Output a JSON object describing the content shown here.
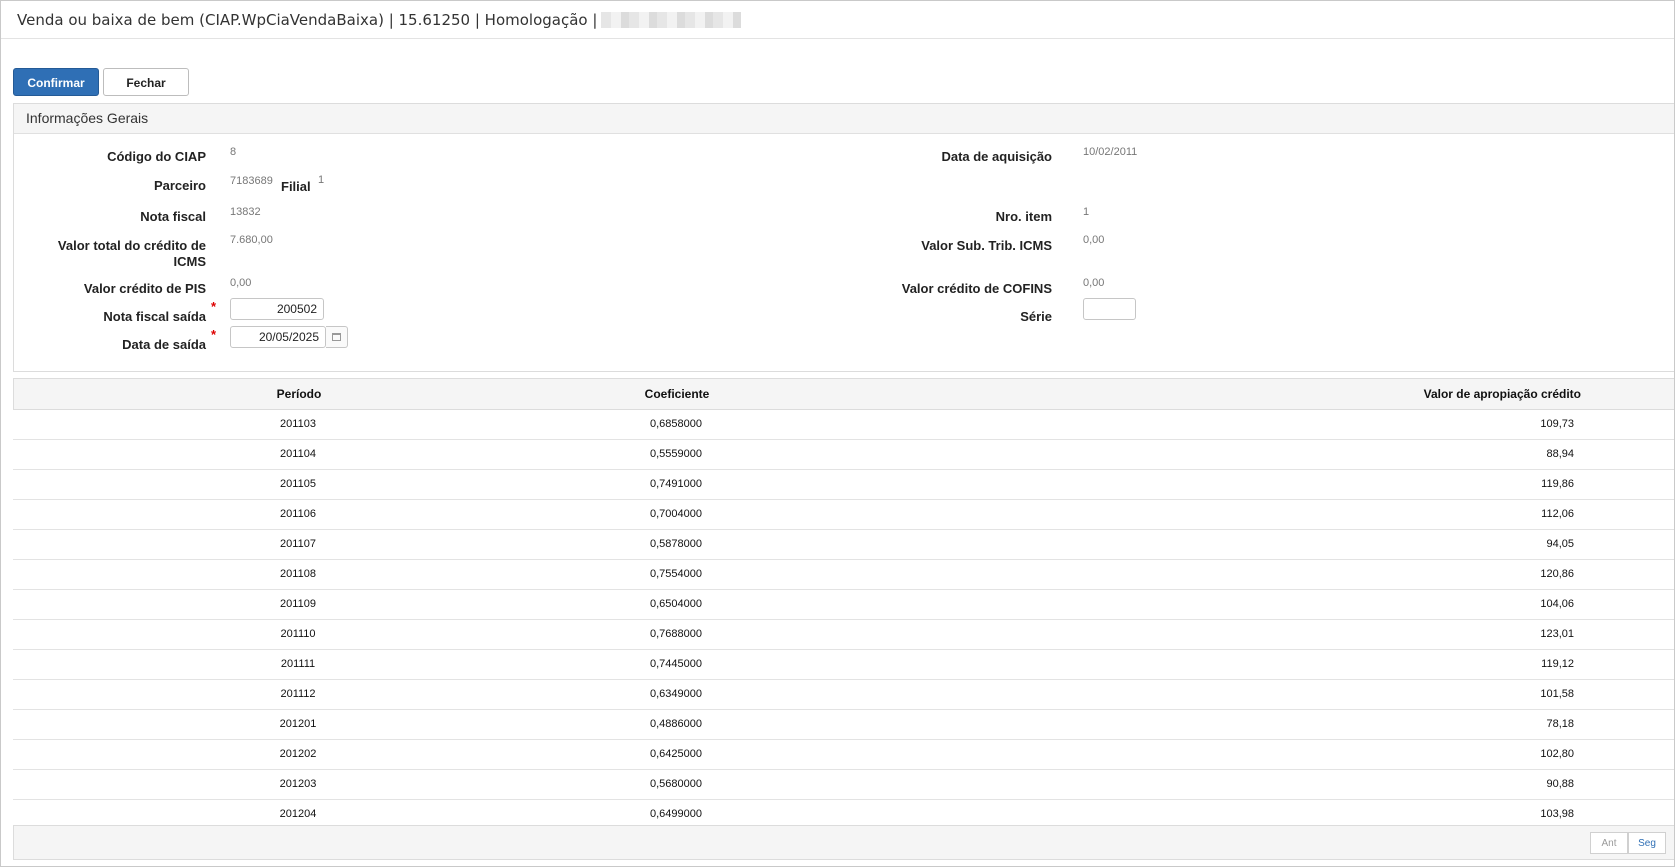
{
  "window": {
    "title": "Venda ou baixa de bem (CIAP.WpCiaVendaBaixa) | 15.61250 | Homologação |"
  },
  "toolbar": {
    "confirm_label": "Confirmar",
    "close_label": "Fechar"
  },
  "panel": {
    "title": "Informações Gerais",
    "fields": {
      "codigo_ciap": {
        "label": "Código do CIAP",
        "value": "8"
      },
      "data_aquisicao": {
        "label": "Data de aquisição",
        "value": "10/02/2011"
      },
      "parceiro": {
        "label": "Parceiro",
        "value": "7183689"
      },
      "filial": {
        "label": "Filial",
        "value": "1"
      },
      "nota_fiscal": {
        "label": "Nota fiscal",
        "value": "13832"
      },
      "nro_item": {
        "label": "Nro. item",
        "value": "1"
      },
      "valor_total_icms": {
        "label": "Valor total do crédito de ICMS",
        "value": "7.680,00"
      },
      "valor_sub_trib": {
        "label": "Valor Sub. Trib. ICMS",
        "value": "0,00"
      },
      "valor_pis": {
        "label": "Valor crédito de PIS",
        "value": "0,00"
      },
      "valor_cofins": {
        "label": "Valor crédito de COFINS",
        "value": "0,00"
      },
      "nota_fiscal_saida": {
        "label": "Nota fiscal saída",
        "value": "200502",
        "required": "*"
      },
      "serie": {
        "label": "Série",
        "value": ""
      },
      "data_saida": {
        "label": "Data de saída",
        "value": "20/05/2025",
        "required": "*"
      }
    }
  },
  "grid": {
    "columns": [
      "Período",
      "Coeficiente",
      "Valor de apropiação crédito"
    ],
    "rows": [
      [
        "201103",
        "0,6858000",
        "109,73"
      ],
      [
        "201104",
        "0,5559000",
        "88,94"
      ],
      [
        "201105",
        "0,7491000",
        "119,86"
      ],
      [
        "201106",
        "0,7004000",
        "112,06"
      ],
      [
        "201107",
        "0,5878000",
        "94,05"
      ],
      [
        "201108",
        "0,7554000",
        "120,86"
      ],
      [
        "201109",
        "0,6504000",
        "104,06"
      ],
      [
        "201110",
        "0,7688000",
        "123,01"
      ],
      [
        "201111",
        "0,7445000",
        "119,12"
      ],
      [
        "201112",
        "0,6349000",
        "101,58"
      ],
      [
        "201201",
        "0,4886000",
        "78,18"
      ],
      [
        "201202",
        "0,6425000",
        "102,80"
      ],
      [
        "201203",
        "0,5680000",
        "90,88"
      ],
      [
        "201204",
        "0,6499000",
        "103,98"
      ]
    ]
  },
  "pager": {
    "prev_label": "Ant",
    "next_label": "Seg"
  }
}
